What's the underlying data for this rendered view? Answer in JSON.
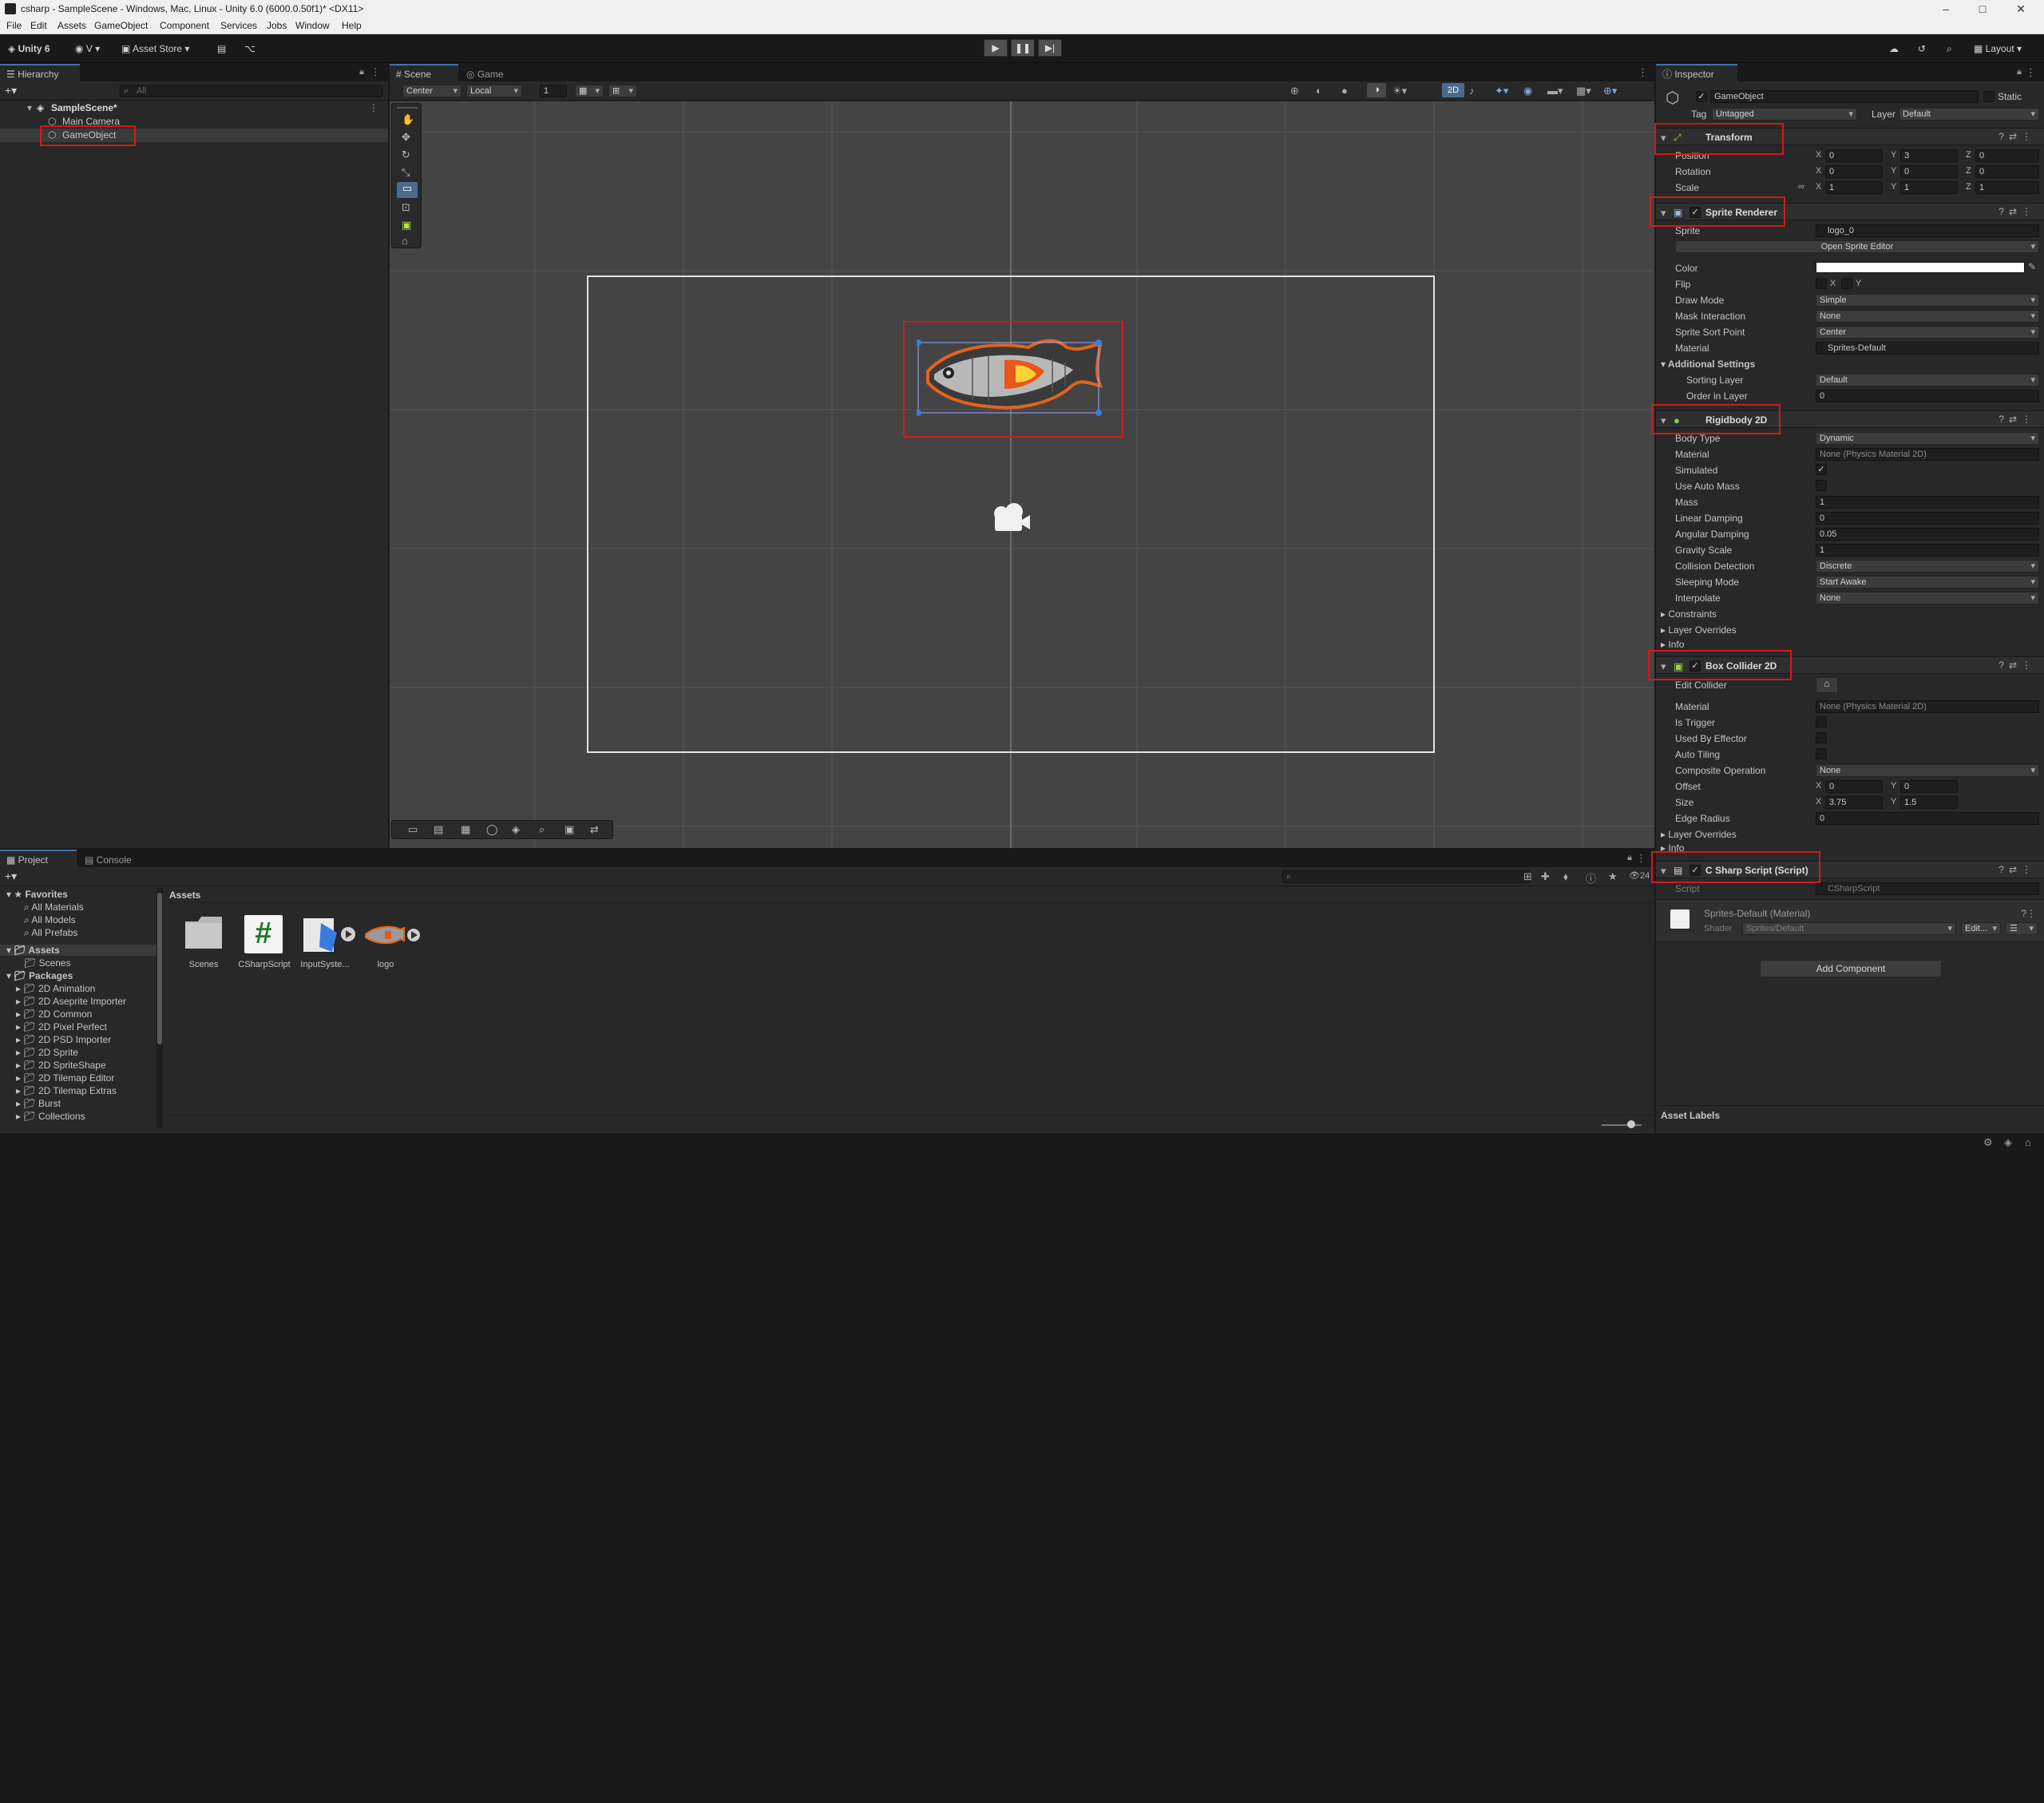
{
  "window": {
    "title": "csharp - SampleScene - Windows, Mac, Linux - Unity 6.0 (6000.0.50f1)* <DX11>"
  },
  "menu": [
    "File",
    "Edit",
    "Assets",
    "GameObject",
    "Component",
    "Services",
    "Jobs",
    "Window",
    "Help"
  ],
  "toolbar": {
    "unity_label": "Unity 6",
    "account_label": "V",
    "asset_store_label": "Asset Store",
    "layout_label": "Layout"
  },
  "hierarchy": {
    "tab": "Hierarchy",
    "search_placeholder": "All",
    "scene": "SampleScene*",
    "items": [
      "Main Camera",
      "GameObject"
    ]
  },
  "scene_view": {
    "tabs": [
      "Scene",
      "Game"
    ],
    "pivot": "Center",
    "space": "Local",
    "grid_value": "1",
    "mode_2d": "2D"
  },
  "inspector": {
    "tab": "Inspector",
    "object_name": "GameObject",
    "static_label": "Static",
    "tag_label": "Tag",
    "tag_value": "Untagged",
    "layer_label": "Layer",
    "layer_value": "Default",
    "transform": {
      "title": "Transform",
      "position_label": "Position",
      "position": {
        "x": "0",
        "y": "3",
        "z": "0"
      },
      "rotation_label": "Rotation",
      "rotation": {
        "x": "0",
        "y": "0",
        "z": "0"
      },
      "scale_label": "Scale",
      "scale": {
        "x": "1",
        "y": "1",
        "z": "1"
      }
    },
    "sprite_renderer": {
      "title": "Sprite Renderer",
      "sprite_label": "Sprite",
      "sprite_value": "logo_0",
      "open_editor": "Open Sprite Editor",
      "color_label": "Color",
      "flip_label": "Flip",
      "flip_x": "X",
      "flip_y": "Y",
      "draw_mode_label": "Draw Mode",
      "draw_mode": "Simple",
      "mask_label": "Mask Interaction",
      "mask": "None",
      "sort_point_label": "Sprite Sort Point",
      "sort_point": "Center",
      "material_label": "Material",
      "material": "Sprites-Default",
      "additional": "Additional Settings",
      "sorting_layer_label": "Sorting Layer",
      "sorting_layer": "Default",
      "order_label": "Order in Layer",
      "order": "0"
    },
    "rigidbody": {
      "title": "Rigidbody 2D",
      "body_type_label": "Body Type",
      "body_type": "Dynamic",
      "material_label": "Material",
      "material": "None (Physics Material 2D)",
      "simulated_label": "Simulated",
      "auto_mass_label": "Use Auto Mass",
      "mass_label": "Mass",
      "mass": "1",
      "linear_label": "Linear Damping",
      "linear": "0",
      "angular_label": "Angular Damping",
      "angular": "0.05",
      "gravity_label": "Gravity Scale",
      "gravity": "1",
      "collision_label": "Collision Detection",
      "collision": "Discrete",
      "sleeping_label": "Sleeping Mode",
      "sleeping": "Start Awake",
      "interpolate_label": "Interpolate",
      "interpolate": "None",
      "constraints": "Constraints",
      "layer_overrides": "Layer Overrides",
      "info": "Info"
    },
    "box_collider": {
      "title": "Box Collider 2D",
      "edit_label": "Edit Collider",
      "material_label": "Material",
      "material": "None (Physics Material 2D)",
      "trigger_label": "Is Trigger",
      "effector_label": "Used By Effector",
      "tiling_label": "Auto Tiling",
      "composite_label": "Composite Operation",
      "composite": "None",
      "offset_label": "Offset",
      "offset": {
        "x": "0",
        "y": "0"
      },
      "size_label": "Size",
      "size": {
        "x": "3.75",
        "y": "1.5"
      },
      "edge_label": "Edge Radius",
      "edge": "0",
      "layer_overrides": "Layer Overrides",
      "info": "Info"
    },
    "script": {
      "title": "C Sharp Script (Script)",
      "script_label": "Script",
      "script_value": "CSharpScript"
    },
    "material": {
      "title": "Sprites-Default (Material)",
      "shader_label": "Shader",
      "shader_value": "Sprites/Default",
      "edit": "Edit..."
    },
    "add_component": "Add Component",
    "asset_labels": "Asset Labels"
  },
  "project": {
    "tabs": [
      "Project",
      "Console"
    ],
    "favorites_label": "Favorites",
    "favorites": [
      "All Materials",
      "All Models",
      "All Prefabs"
    ],
    "assets_label": "Assets",
    "asset_folders": [
      "Scenes"
    ],
    "packages_label": "Packages",
    "packages": [
      "2D Animation",
      "2D Aseprite Importer",
      "2D Common",
      "2D Pixel Perfect",
      "2D PSD Importer",
      "2D Sprite",
      "2D SpriteShape",
      "2D Tilemap Editor",
      "2D Tilemap Extras",
      "Burst",
      "Collections"
    ],
    "breadcrumb": "Assets",
    "files": [
      "Scenes",
      "CSharpScript",
      "InputSyste...",
      "logo"
    ],
    "item_count": "24"
  },
  "colors": {
    "accent": "#3a72b0",
    "highlight": "#d41919",
    "selection": "#2c5d87"
  }
}
